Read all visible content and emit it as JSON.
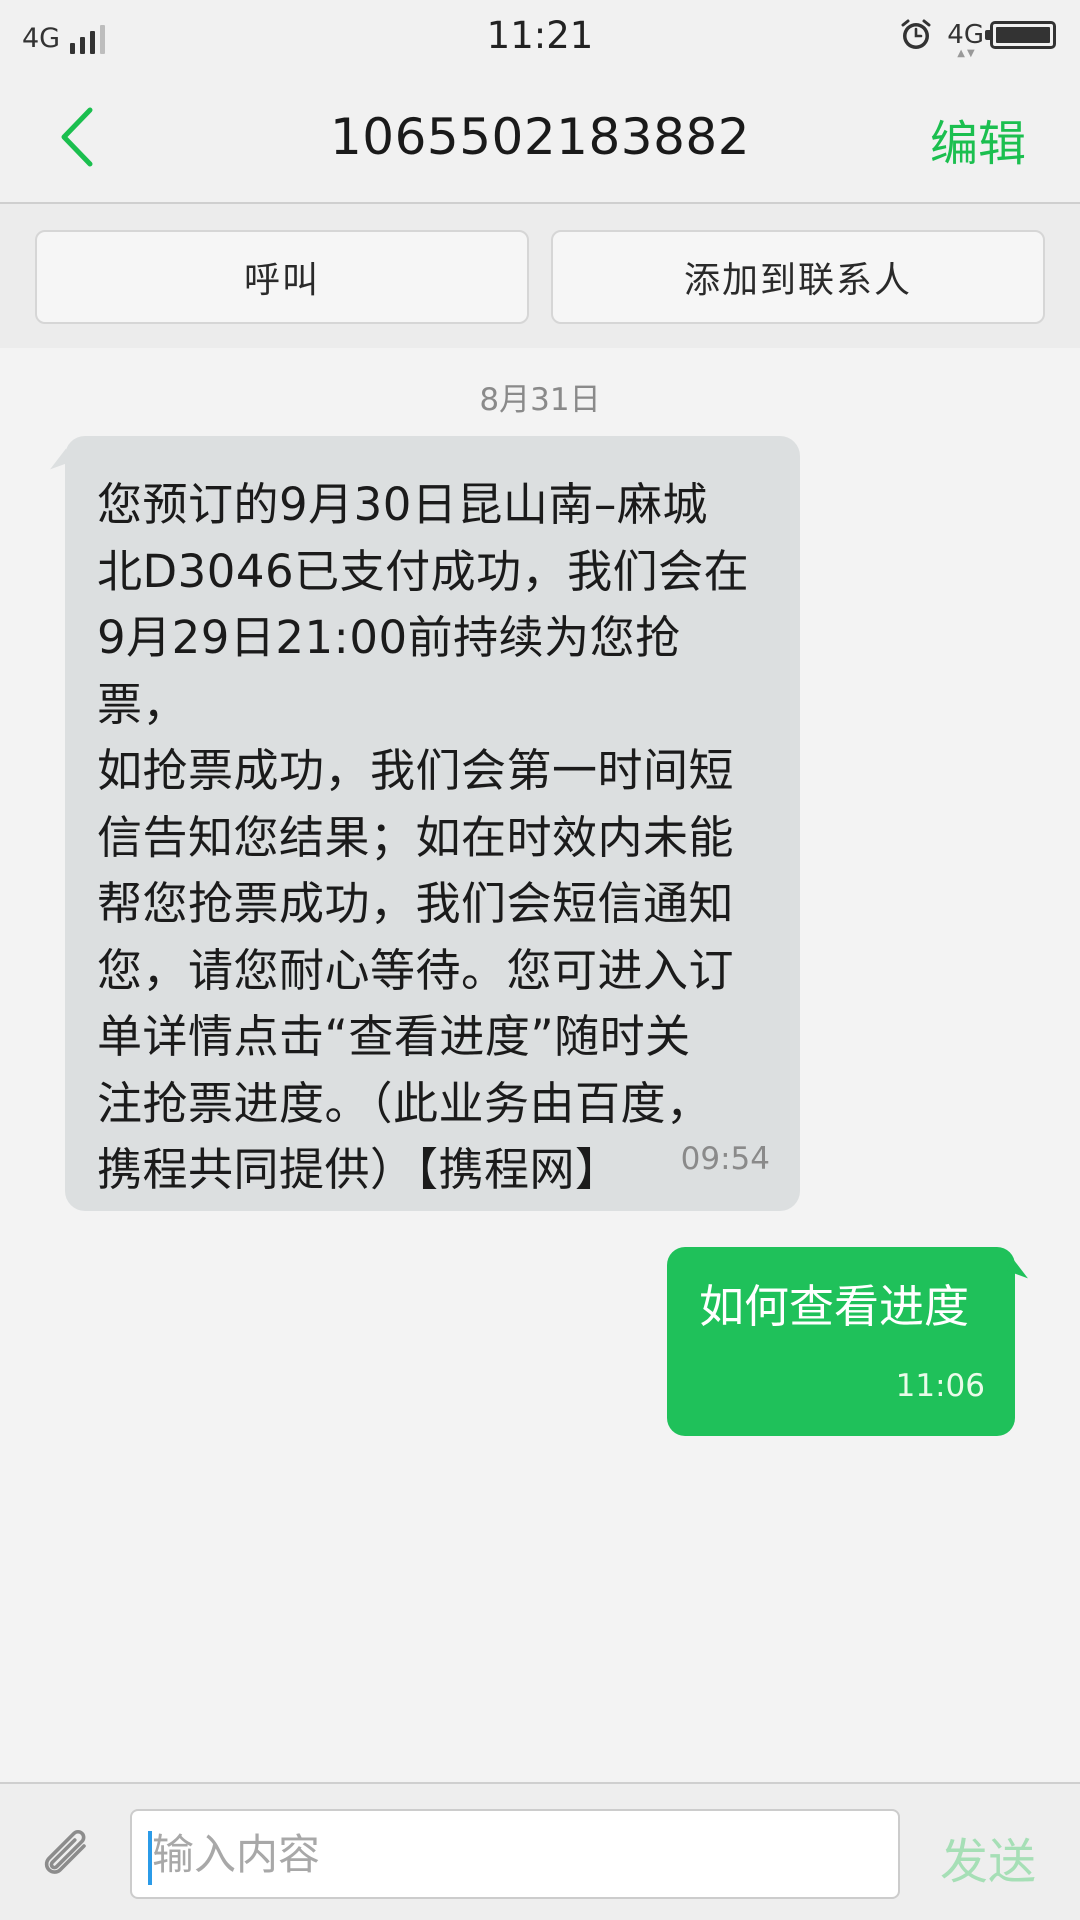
{
  "status_bar": {
    "network_left": "4G",
    "time": "11:21",
    "network_right": "4G"
  },
  "header": {
    "back_icon": "chevron-left-icon",
    "title": "1065502183882",
    "edit_label": "编辑"
  },
  "actions": {
    "call_label": "呼叫",
    "add_contact_label": "添加到联系人"
  },
  "conversation": {
    "date": "8月31日",
    "messages": [
      {
        "direction": "incoming",
        "lines": [
          "您预订的9月30日昆山南–麻城",
          "北D3046已支付成功，我们会在",
          "9月29日21:00前持续为您抢票，",
          "如抢票成功，我们会第一时间短",
          "信告知您结果；如在时效内未能",
          "帮您抢票成功，我们会短信通知",
          "您，请您耐心等待。您可进入订",
          "单详情点击“查看进度”随时关",
          "注抢票进度。（此业务由百度，",
          "携程共同提供）【携程网】"
        ],
        "time": "09:54"
      },
      {
        "direction": "outgoing",
        "text": "如何查看进度",
        "time": "11:06"
      }
    ]
  },
  "composer": {
    "attach_icon": "paperclip-icon",
    "placeholder": "输入内容",
    "send_label": "发送"
  },
  "colors": {
    "accent": "#1bbf4f",
    "outgoing_bubble": "#1fc15a",
    "incoming_bubble": "#dcdfe0",
    "send_disabled": "#a6dfb6"
  }
}
